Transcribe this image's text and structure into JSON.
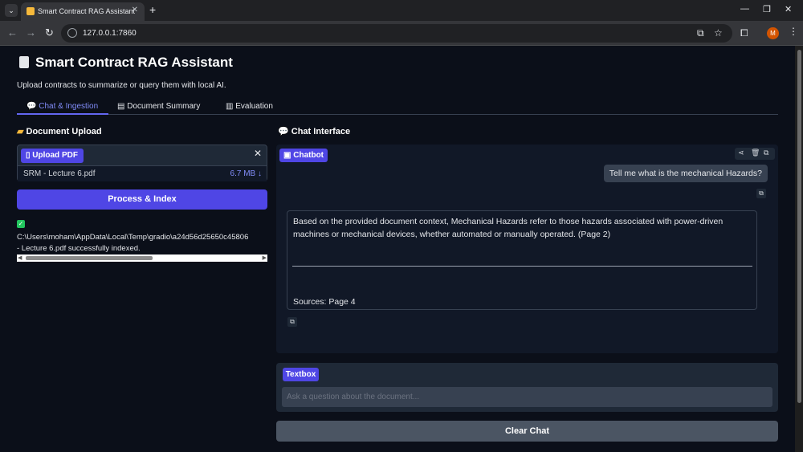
{
  "browser": {
    "tab_title": "Smart Contract RAG Assistant",
    "url": "127.0.0.1:7860",
    "profile_initial": "M",
    "new_tab": "+",
    "tab_close": "✕"
  },
  "app": {
    "title": "Smart Contract RAG Assistant",
    "subtitle": "Upload contracts to summarize or query them with local AI."
  },
  "tabs": [
    {
      "label": "Chat & Ingestion",
      "active": true
    },
    {
      "label": "Document Summary",
      "active": false
    },
    {
      "label": "Evaluation",
      "active": false
    }
  ],
  "left": {
    "section_title": "Document Upload",
    "upload_label": "Upload PDF",
    "file_name": "SRM - Lecture 6.pdf",
    "file_size": "6.7 MB ↓",
    "process_button": "Process & Index",
    "status_line1": "C:\\Users\\moham\\AppData\\Local\\Temp\\gradio\\a24d56d25650c45806",
    "status_line2": "- Lecture 6.pdf successfully indexed."
  },
  "right": {
    "section_title": "Chat Interface",
    "chatbot_label": "Chatbot",
    "user_message": "Tell me what is the mechanical Hazards?",
    "bot_message": "Based on the provided document context, Mechanical Hazards refer to those hazards associated with power-driven machines or mechanical devices, whether automated or manually operated. (Page 2)",
    "bot_sources": "Sources: Page 4",
    "textbox_label": "Textbox",
    "textbox_placeholder": "Ask a question about the document...",
    "clear_button": "Clear Chat"
  },
  "colors": {
    "accent": "#4f46e5",
    "accent_text": "#818cf8",
    "background": "#0b0f19",
    "panel": "#111827"
  }
}
